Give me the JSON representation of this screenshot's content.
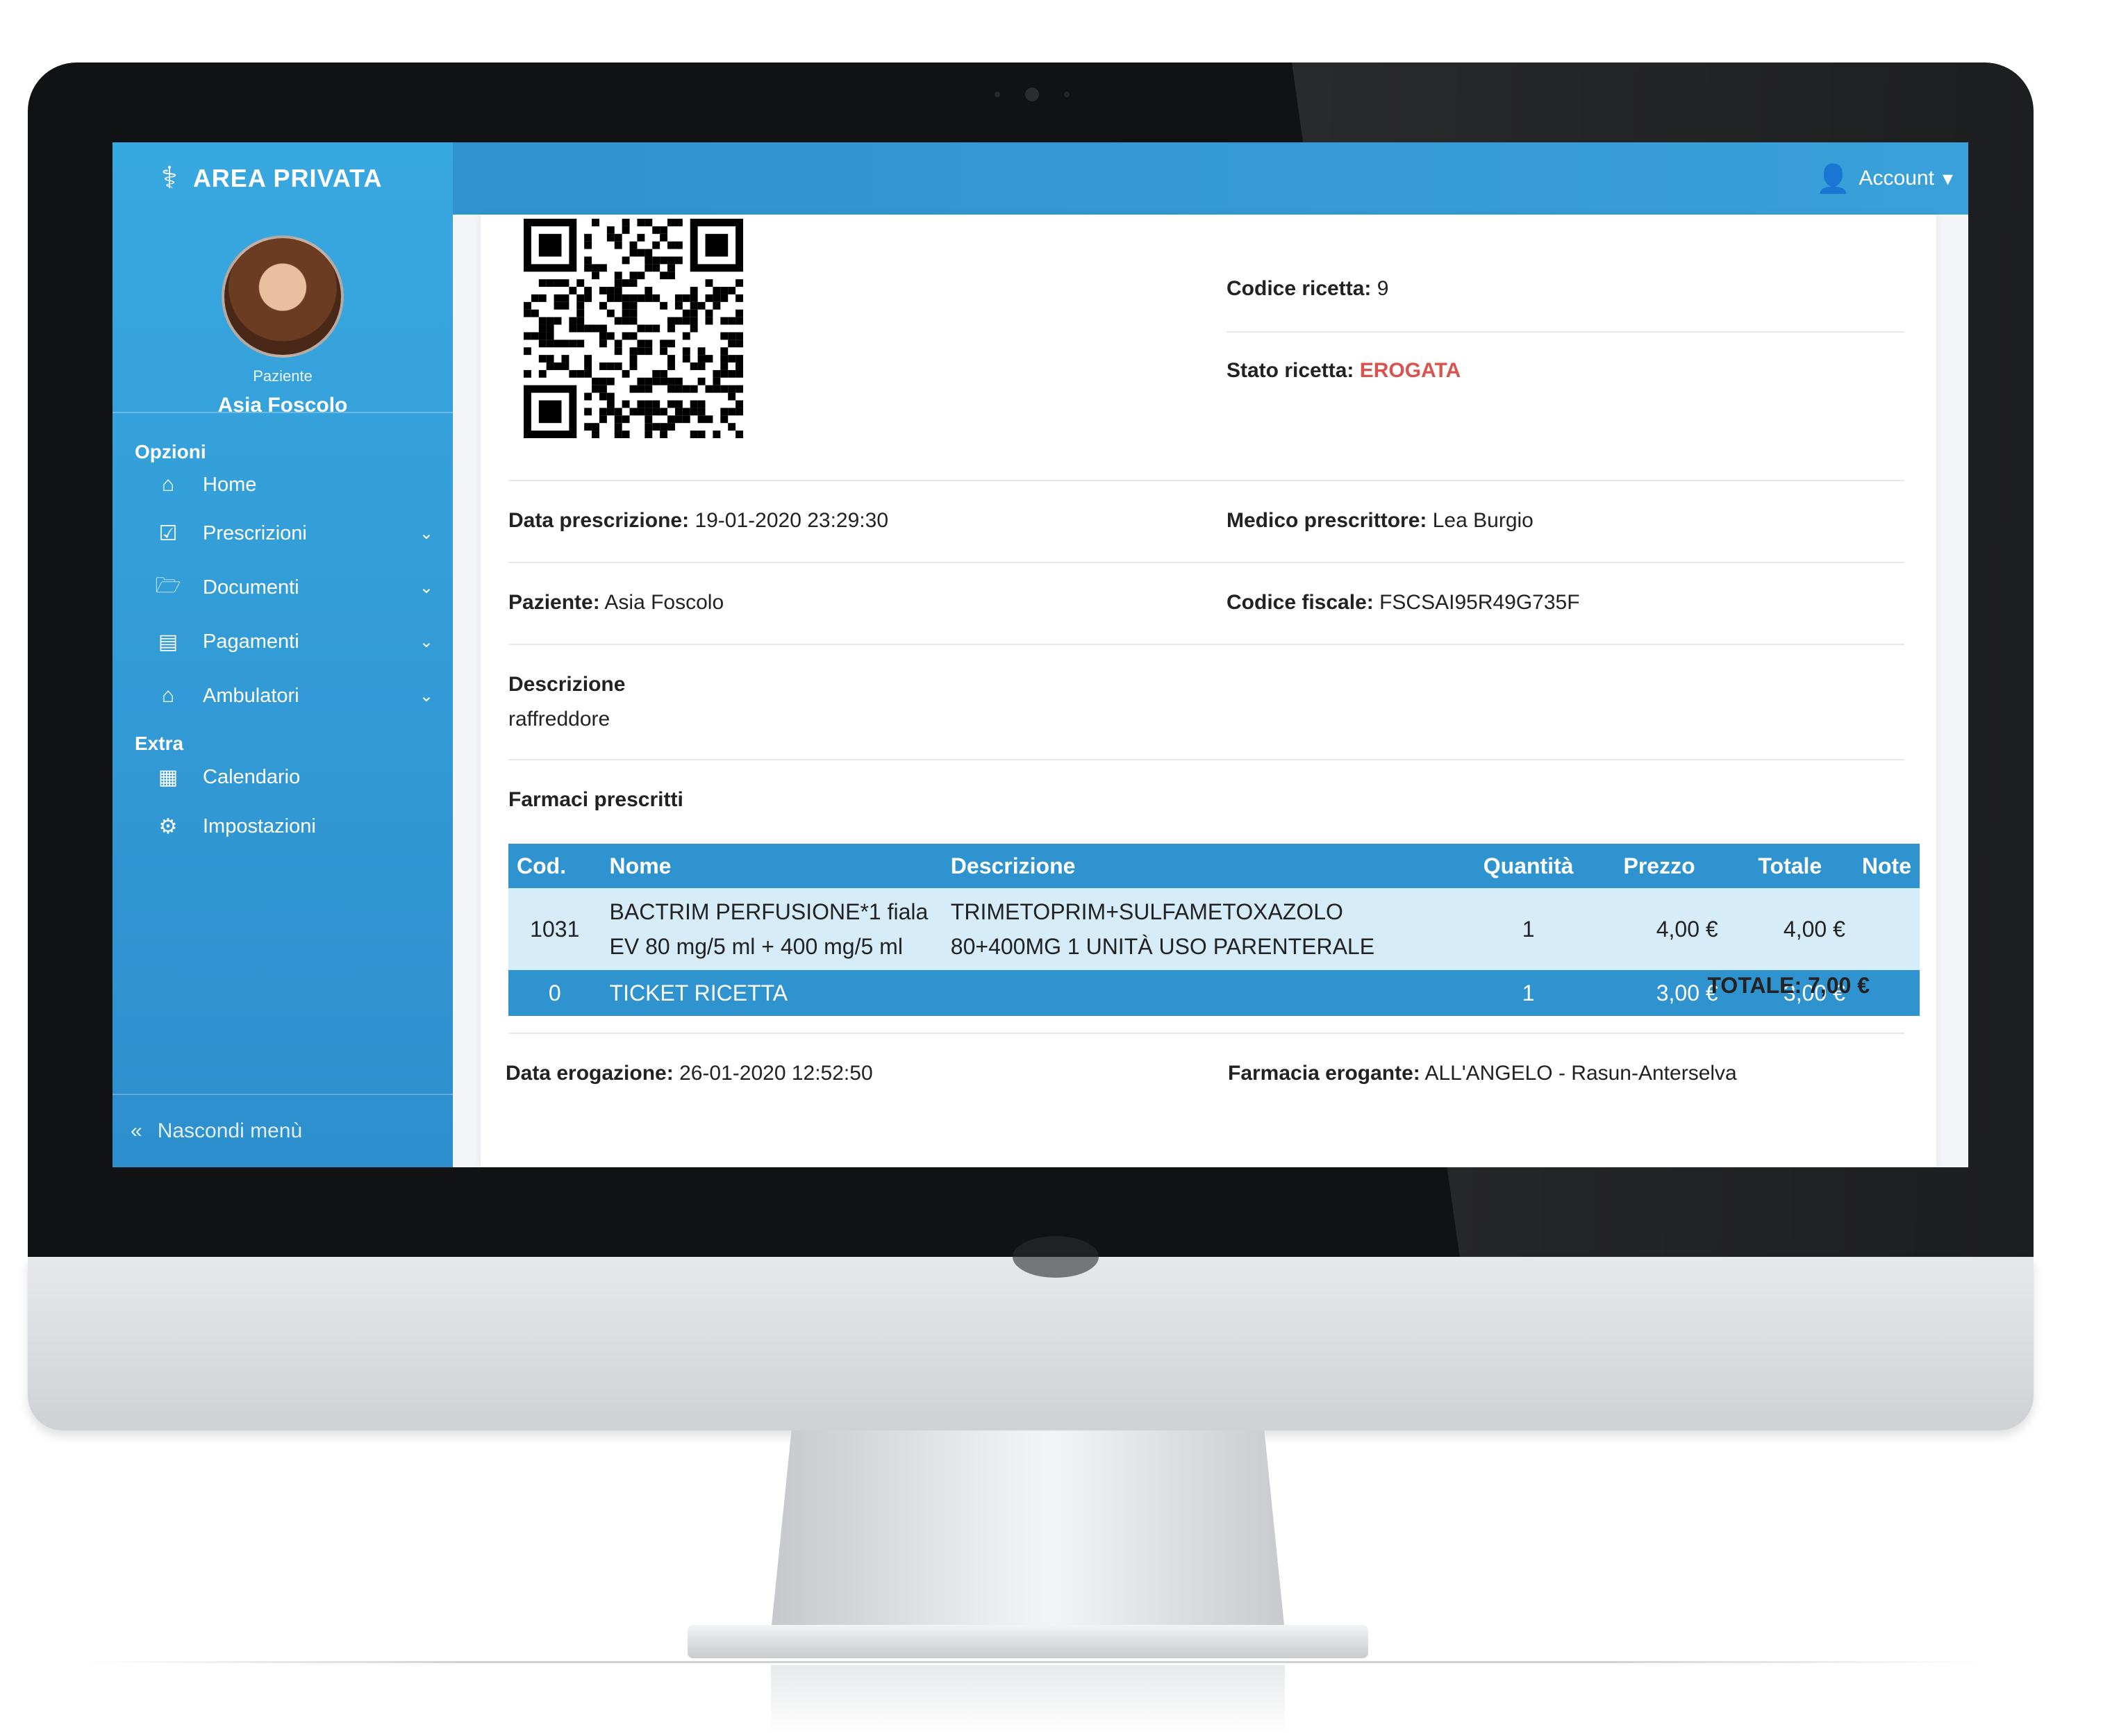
{
  "brand": {
    "title": "AREA PRIVATA"
  },
  "account": {
    "label": "Account"
  },
  "profile": {
    "role": "Paziente",
    "name": "Asia Foscolo"
  },
  "sidebar": {
    "section_options": "Opzioni",
    "items": [
      {
        "label": "Home",
        "icon": "home-icon",
        "expandable": false
      },
      {
        "label": "Prescrizioni",
        "icon": "calendar-check-icon",
        "expandable": true
      },
      {
        "label": "Documenti",
        "icon": "folder-open-icon",
        "expandable": true
      },
      {
        "label": "Pagamenti",
        "icon": "money-bill-icon",
        "expandable": true
      },
      {
        "label": "Ambulatori",
        "icon": "house-medical-icon",
        "expandable": true
      }
    ],
    "section_extra": "Extra",
    "extra_items": [
      {
        "label": "Calendario",
        "icon": "calendar-icon"
      },
      {
        "label": "Impostazioni",
        "icon": "gear-icon"
      }
    ],
    "hide_menu": "Nascondi menù"
  },
  "prescription": {
    "codice_label": "Codice ricetta:",
    "codice_value": "9",
    "stato_label": "Stato ricetta:",
    "stato_value": "EROGATA",
    "data_prescrizione_label": "Data prescrizione:",
    "data_prescrizione_value": "19-01-2020 23:29:30",
    "medico_label": "Medico prescrittore:",
    "medico_value": "Lea Burgio",
    "paziente_label": "Paziente:",
    "paziente_value": "Asia Foscolo",
    "codice_fiscale_label": "Codice fiscale:",
    "codice_fiscale_value": "FSCSAI95R49G735F",
    "descrizione_label": "Descrizione",
    "descrizione_value": "raffreddore",
    "farmaci_title": "Farmaci prescritti"
  },
  "table": {
    "headers": [
      "Cod.",
      "Nome",
      "Descrizione",
      "Quantità",
      "Prezzo",
      "Totale",
      "Note"
    ],
    "rows": [
      {
        "cod": "1031",
        "nome_1": "BACTRIM PERFUSIONE*1 fiala",
        "nome_2": "EV 80 mg/5 ml + 400 mg/5 ml",
        "descrizione_1": "TRIMETOPRIM+SULFAMETOXAZOLO",
        "descrizione_2": "80+400MG 1 UNITÀ USO PARENTERALE",
        "quantita": "1",
        "prezzo": "4,00 €",
        "totale": "4,00 €",
        "note": ""
      },
      {
        "cod": "0",
        "nome": "TICKET RICETTA",
        "descrizione": "",
        "quantita": "1",
        "prezzo": "3,00 €",
        "totale": "3,00 €",
        "note": ""
      }
    ],
    "totale_label": "TOTALE:",
    "totale_value": "7,00 €"
  },
  "erogazione": {
    "data_label": "Data erogazione:",
    "data_value": "26-01-2020 12:52:50",
    "farmacia_label": "Farmacia erogante:",
    "farmacia_value": "ALL'ANGELO - Rasun-Anterselva"
  },
  "colors": {
    "sidebar": "#38a8e0",
    "header": "#2f93d0",
    "status": "#d9534f",
    "row_light": "#d7ecf9"
  }
}
